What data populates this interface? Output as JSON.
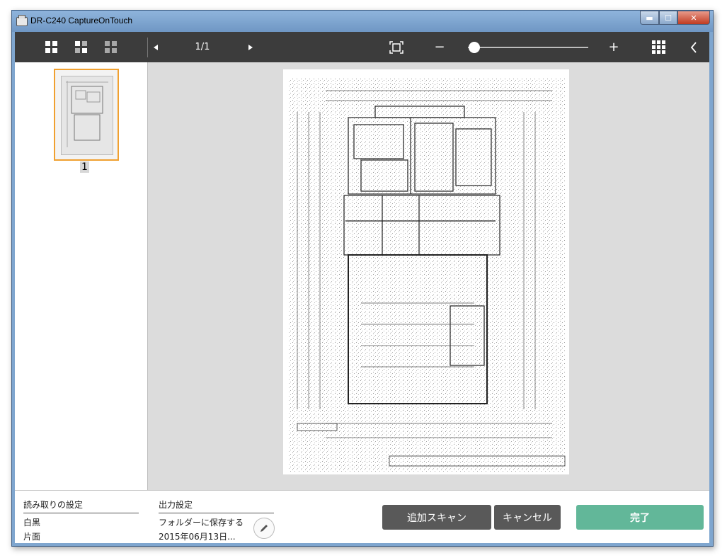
{
  "window": {
    "title": "DR-C240 CaptureOnTouch",
    "controls": {
      "minimize": "▬",
      "maximize": "☐",
      "close": "✕"
    }
  },
  "toolbar": {
    "view_icons": [
      "large-grid-icon",
      "medium-grid-icon",
      "small-grid-icon"
    ],
    "prev_icon": "prev-page-icon",
    "page_indicator": "1/1",
    "next_icon": "next-page-icon",
    "fit_icon": "fit-page-icon",
    "zoom_out": "−",
    "zoom_level": 0.0,
    "zoom_in": "+",
    "thumbnail_grid_icon": "apps-grid-icon",
    "collapse_icon": "chevron-left-icon",
    "colors": {
      "bar": "#3c3c3c",
      "icons": "#ffffff"
    }
  },
  "thumbnails": [
    {
      "label": "1",
      "selected": true
    }
  ],
  "settings": {
    "scan": {
      "title": "読み取りの設定",
      "color_mode": "白黒",
      "side": "片面"
    },
    "output": {
      "title": "出力設定",
      "method": "フォルダーに保存する",
      "filename": "2015年06月13日..."
    }
  },
  "actions": {
    "additional_scan": "追加スキャン",
    "cancel": "キャンセル",
    "done": "完了",
    "colors": {
      "secondary": "#595959",
      "primary": "#62b799"
    }
  }
}
